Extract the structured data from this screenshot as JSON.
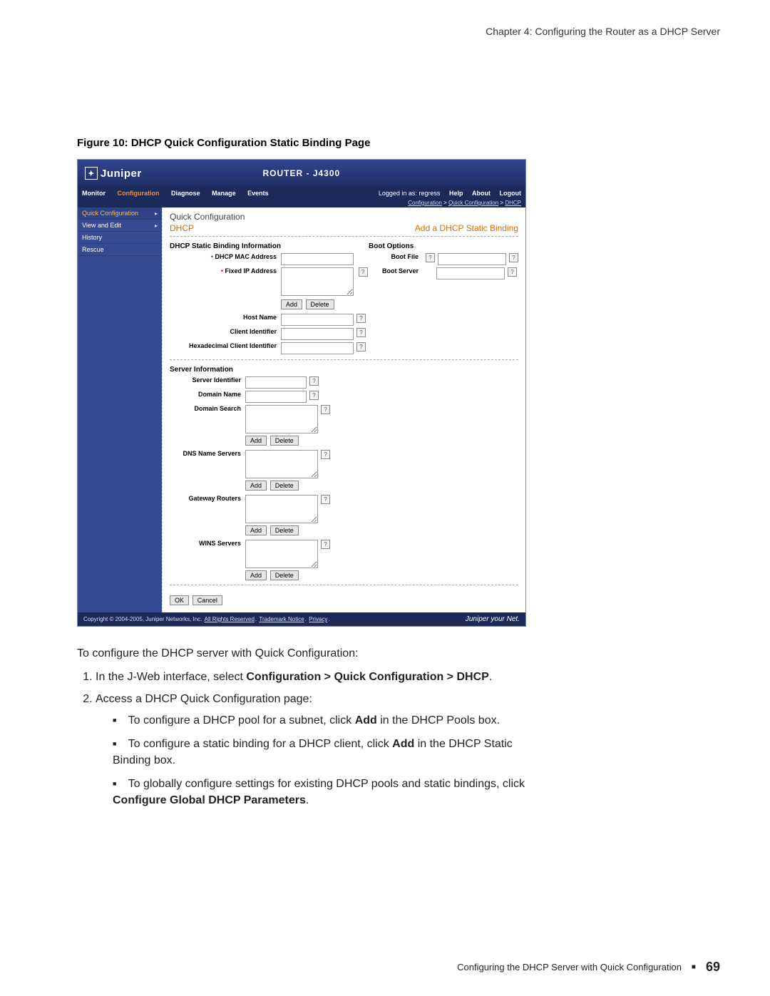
{
  "chapter_header": "Chapter 4: Configuring the Router as a DHCP Server",
  "figure_caption": "Figure 10: DHCP Quick Configuration Static Binding Page",
  "shot": {
    "logo_text": "Juniper",
    "router_title": "ROUTER - J4300",
    "nav_left": [
      "Monitor",
      "Configuration",
      "Diagnose",
      "Manage",
      "Events"
    ],
    "nav_active": "Configuration",
    "logged_in": "Logged in as: regress",
    "nav_right": [
      "Help",
      "About",
      "Logout"
    ],
    "breadcrumb": [
      "Configuration",
      "Quick Configuration",
      "DHCP"
    ],
    "sidebar": [
      {
        "label": "Quick Configuration",
        "sel": true,
        "arrow": true
      },
      {
        "label": "View and Edit",
        "sel": false,
        "arrow": true
      },
      {
        "label": "History",
        "sel": false,
        "arrow": false
      },
      {
        "label": "Rescue",
        "sel": false,
        "arrow": false
      }
    ],
    "content_title": "Quick Configuration",
    "content_sub_left": "DHCP",
    "content_sub_right": "Add a DHCP Static Binding",
    "sec_binding": "DHCP Static Binding Information",
    "sec_boot": "Boot Options",
    "fields": {
      "mac": "DHCP MAC Address",
      "fixedip": "Fixed IP Address",
      "hostname": "Host Name",
      "clientid": "Client Identifier",
      "hexclientid": "Hexadecimal Client Identifier",
      "bootfile": "Boot File",
      "bootserver": "Boot Server"
    },
    "sec_server": "Server Information",
    "server_fields": {
      "serverid": "Server Identifier",
      "domainname": "Domain Name",
      "domainsearch": "Domain Search",
      "dns": "DNS Name Servers",
      "gateway": "Gateway Routers",
      "wins": "WINS Servers"
    },
    "btn_add": "Add",
    "btn_delete": "Delete",
    "btn_ok": "OK",
    "btn_cancel": "Cancel",
    "footer_copy": "Copyright © 2004-2005, Juniper Networks, Inc.",
    "footer_links": [
      "All Rights Reserved",
      "Trademark Notice",
      "Privacy"
    ],
    "footer_tag": "Juniper your Net."
  },
  "body": {
    "intro": "To configure the DHCP server with Quick Configuration:",
    "step1_a": "In the J-Web interface, select ",
    "step1_b": "Configuration > Quick Configuration > DHCP",
    "step1_c": ".",
    "step2": "Access a DHCP Quick Configuration page:",
    "bullet1_a": "To configure a DHCP pool for a subnet, click ",
    "bullet1_b": "Add",
    "bullet1_c": " in the DHCP Pools box.",
    "bullet2_a": "To configure a static binding for a DHCP client, click ",
    "bullet2_b": "Add",
    "bullet2_c": " in the DHCP Static Binding box.",
    "bullet3_a": "To globally configure settings for existing DHCP pools and static bindings, click ",
    "bullet3_b": "Configure Global DHCP Parameters",
    "bullet3_c": "."
  },
  "footer": {
    "text": "Configuring the DHCP Server with Quick Configuration",
    "page": "69"
  }
}
